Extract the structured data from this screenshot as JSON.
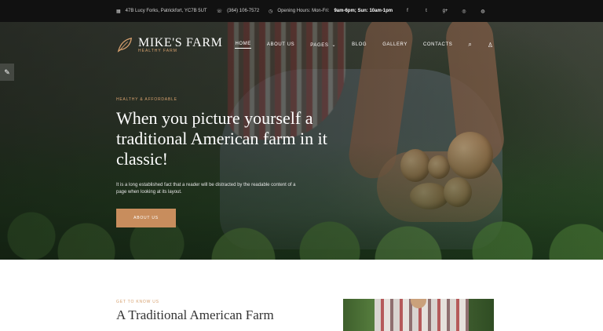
{
  "topbar": {
    "address": "47B Lucy Forks, Patrickfort, YC7B 5UT",
    "phone": "(364) 106-7572",
    "hours_label": "Opening Hours: Mon-Fri:",
    "hours_value": "9am-6pm; Sun: 10am-1pm",
    "social_icons": [
      "facebook-icon",
      "twitter-icon",
      "google-plus-icon",
      "instagram-icon",
      "globe-icon"
    ]
  },
  "brand": {
    "name": "MIKE'S FARM",
    "tagline": "HEALTHY FARM"
  },
  "nav": {
    "items": [
      {
        "label": "HOME",
        "active": true
      },
      {
        "label": "ABOUT US"
      },
      {
        "label": "PAGES",
        "dropdown": true
      },
      {
        "label": "BLOG"
      },
      {
        "label": "GALLERY"
      },
      {
        "label": "CONTACTS"
      }
    ],
    "icons": [
      "search-icon",
      "user-icon"
    ]
  },
  "hero": {
    "eyebrow": "HEALTHY & AFFORDABLE",
    "headline": "When you picture yourself a traditional American farm in it classic!",
    "description": "It is a long established fact that a reader will be distracted by the readable content of a page when looking at its layout.",
    "cta_label": "ABOUT US"
  },
  "section": {
    "eyebrow": "GET TO KNOW US",
    "title": "A Traditional American Farm"
  },
  "colors": {
    "accent": "#c88d5d",
    "topbar_bg": "#111111"
  }
}
